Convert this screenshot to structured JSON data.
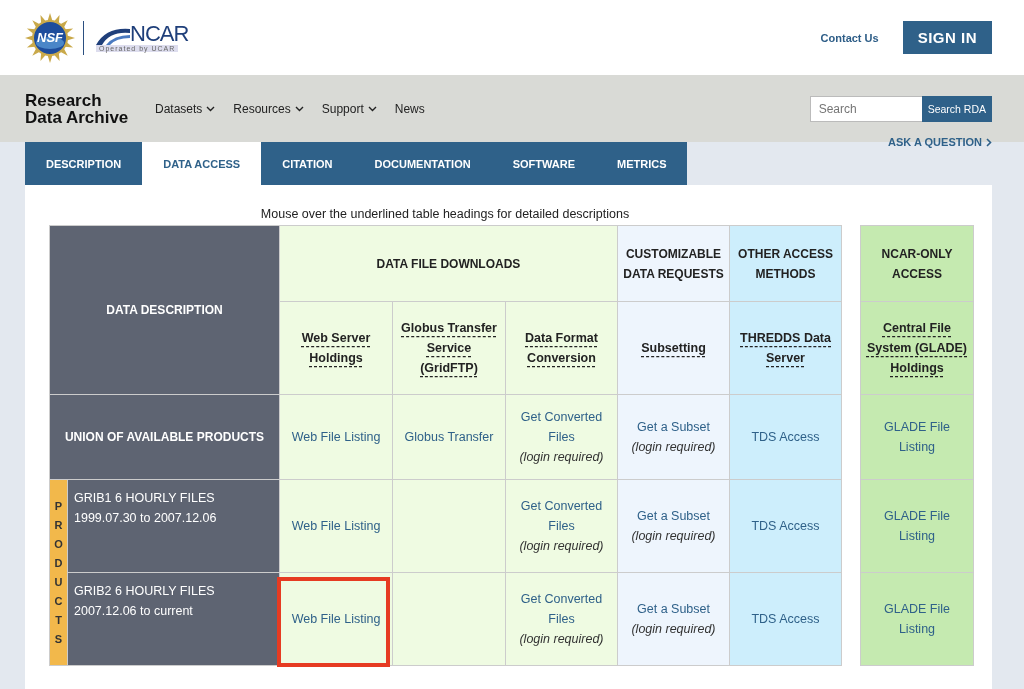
{
  "header": {
    "nsf_logo": "NSF",
    "ncar_logo": "NCAR",
    "ncar_tagline": "Operated by UCAR",
    "contact": "Contact Us",
    "sign_in": "SIGN IN"
  },
  "nav": {
    "brand": "Research Data Archive",
    "menu": [
      {
        "label": "Datasets",
        "dropdown": true
      },
      {
        "label": "Resources",
        "dropdown": true
      },
      {
        "label": "Support",
        "dropdown": true
      },
      {
        "label": "News",
        "dropdown": false
      }
    ],
    "search": {
      "placeholder": "Search",
      "button": "Search RDA"
    }
  },
  "tabs": [
    {
      "label": "DESCRIPTION",
      "selected": false
    },
    {
      "label": "DATA ACCESS",
      "selected": true
    },
    {
      "label": "CITATION",
      "selected": false
    },
    {
      "label": "DOCUMENTATION",
      "selected": false
    },
    {
      "label": "SOFTWARE",
      "selected": false
    },
    {
      "label": "METRICS",
      "selected": false
    }
  ],
  "ask_link": "ASK A QUESTION",
  "note": "Mouse over the underlined table headings for detailed descriptions",
  "table": {
    "description_heading": "DATA DESCRIPTION",
    "products_label": "PRODUCTS",
    "groups": [
      {
        "title": "DATA FILE DOWNLOADS",
        "color": "#effbe2",
        "detached": false,
        "columns": [
          "Web Server Holdings",
          "Globus Transfer Service (GridFTP)",
          "Data Format Conversion"
        ]
      },
      {
        "title": "CUSTOMIZABLE DATA REQUESTS",
        "color": "#eef5fd",
        "detached": false,
        "columns": [
          "Subsetting"
        ]
      },
      {
        "title": "OTHER ACCESS METHODS",
        "color": "#cdeefc",
        "detached": false,
        "columns": [
          "THREDDS Data Server"
        ]
      },
      {
        "title": "NCAR-ONLY ACCESS",
        "color": "#c5eab0",
        "detached": true,
        "columns": [
          "Central File System (GLADE) Holdings"
        ]
      }
    ],
    "rows": [
      {
        "label": "UNION OF AVAILABLE PRODUCTS",
        "kind": "union",
        "cells": [
          {
            "kind": "link",
            "text": "Web File Listing",
            "highlighted": false
          },
          {
            "kind": "link",
            "text": "Globus Transfer",
            "highlighted": false
          },
          {
            "kind": "link",
            "text": "Get Converted Files",
            "note": "(login required)",
            "highlighted": false
          },
          {
            "kind": "link",
            "text": "Get a Subset",
            "note": "(login required)",
            "highlighted": false
          },
          {
            "kind": "link",
            "text": "TDS Access",
            "highlighted": false
          },
          {
            "kind": "link",
            "text": "GLADE File Listing",
            "highlighted": false
          }
        ]
      },
      {
        "label": "GRIB1 6 HOURLY FILES 1999.07.30 to 2007.12.06",
        "kind": "product",
        "cells": [
          {
            "kind": "link",
            "text": "Web File Listing",
            "highlighted": false
          },
          {
            "kind": "empty"
          },
          {
            "kind": "link",
            "text": "Get Converted Files",
            "note": "(login required)",
            "highlighted": false
          },
          {
            "kind": "link",
            "text": "Get a Subset",
            "note": "(login required)",
            "highlighted": false
          },
          {
            "kind": "link",
            "text": "TDS Access",
            "highlighted": false
          },
          {
            "kind": "link",
            "text": "GLADE File Listing",
            "highlighted": false
          }
        ]
      },
      {
        "label": "GRIB2 6 HOURLY FILES 2007.12.06 to current",
        "kind": "product",
        "cells": [
          {
            "kind": "link",
            "text": "Web File Listing",
            "highlighted": true
          },
          {
            "kind": "empty"
          },
          {
            "kind": "link",
            "text": "Get Converted Files",
            "note": "(login required)",
            "highlighted": false
          },
          {
            "kind": "link",
            "text": "Get a Subset",
            "note": "(login required)",
            "highlighted": false
          },
          {
            "kind": "link",
            "text": "TDS Access",
            "highlighted": false
          },
          {
            "kind": "link",
            "text": "GLADE File Listing",
            "highlighted": false
          }
        ]
      }
    ]
  }
}
